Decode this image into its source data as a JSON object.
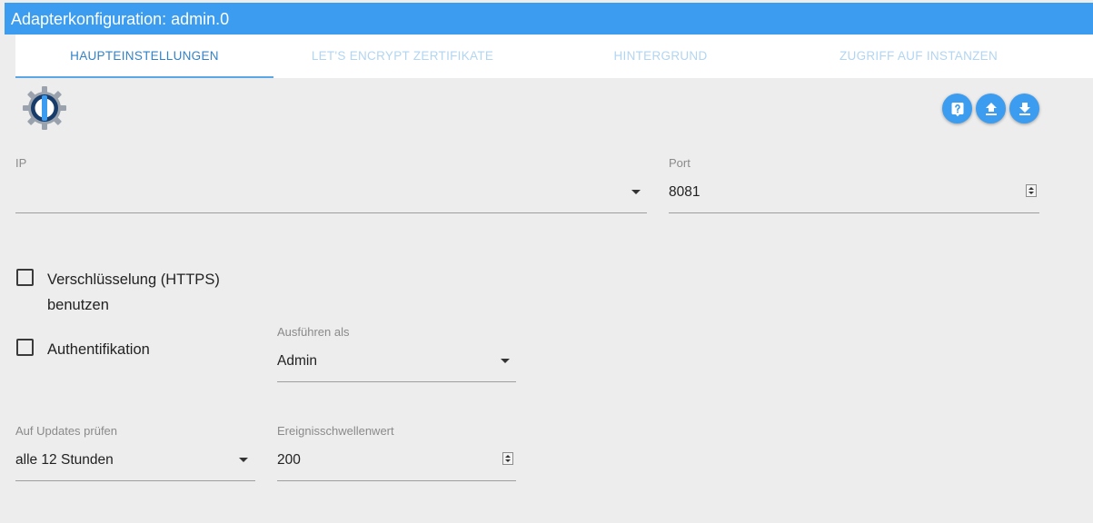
{
  "window": {
    "title": "Adapterkonfiguration: admin.0"
  },
  "tabs": [
    {
      "label": "HAUPTEINSTELLUNGEN",
      "active": true
    },
    {
      "label": "LET'S ENCRYPT ZERTIFIKATE",
      "active": false
    },
    {
      "label": "HINTERGRUND",
      "active": false
    },
    {
      "label": "ZUGRIFF AUF INSTANZEN",
      "active": false
    }
  ],
  "toolbar": {
    "help_icon": "help-icon",
    "upload_icon": "upload-icon",
    "download_icon": "download-icon"
  },
  "fields": {
    "ip": {
      "label": "IP",
      "value": ""
    },
    "port": {
      "label": "Port",
      "value": "8081"
    },
    "https": {
      "label_line1": "Verschlüsselung (HTTPS)",
      "label_line2": "benutzen",
      "checked": false
    },
    "auth": {
      "label": "Authentifikation",
      "checked": false
    },
    "run_as": {
      "label": "Ausführen als",
      "value": "Admin"
    },
    "updates": {
      "label": "Auf Updates prüfen",
      "value": "alle 12 Stunden"
    },
    "threshold": {
      "label": "Ereignisschwellenwert",
      "value": "200"
    }
  },
  "colors": {
    "accent": "#3b9cf0",
    "tab_active": "#3482c6",
    "tab_inactive": "#b2d5f2",
    "background": "#ededed"
  }
}
